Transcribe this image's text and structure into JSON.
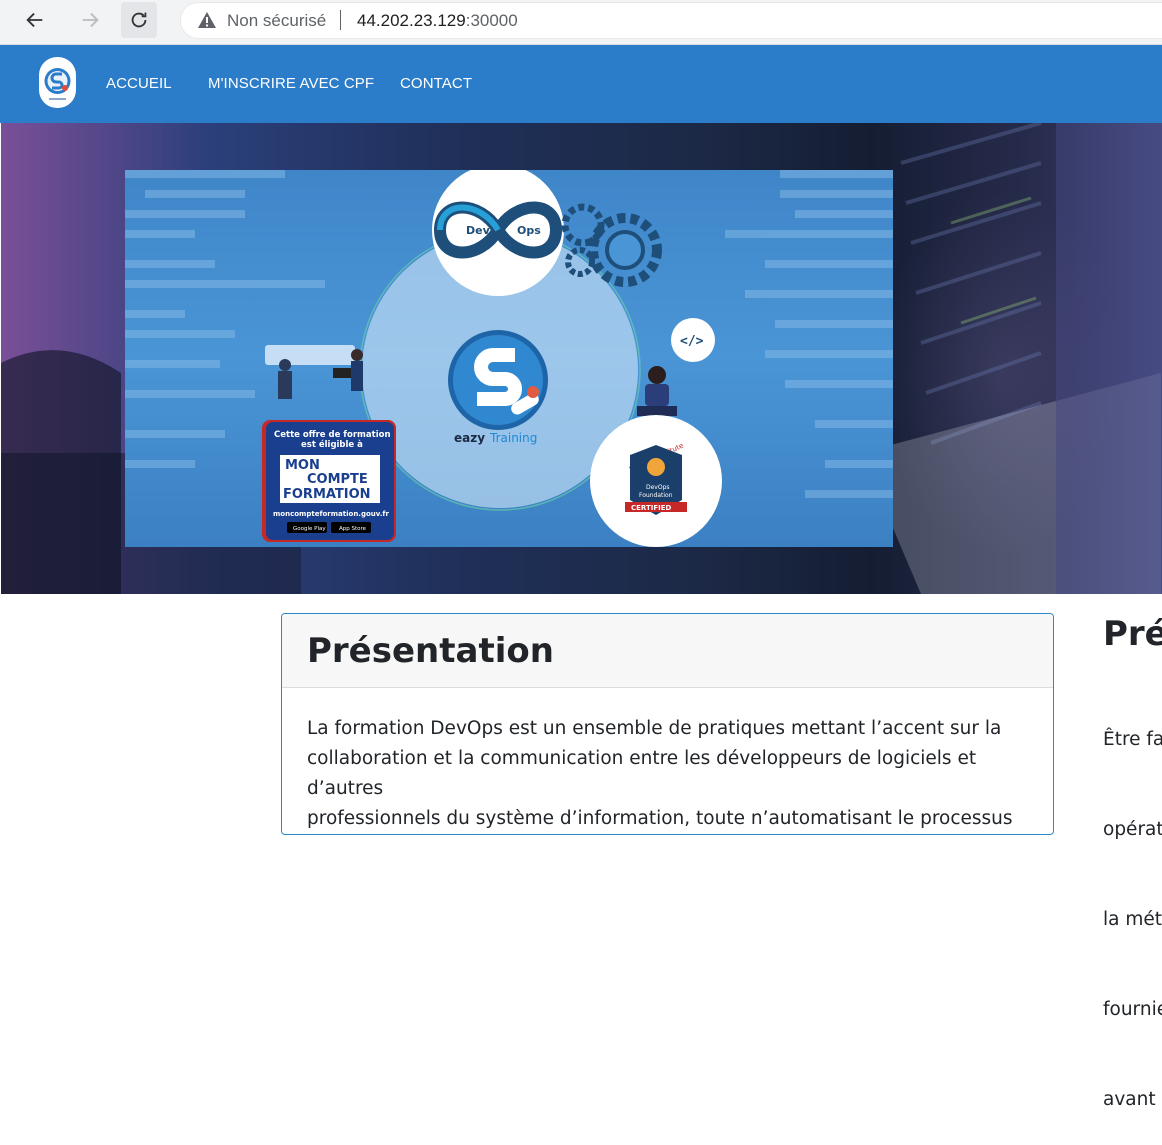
{
  "browser": {
    "security_label": "Non sécurisé",
    "url_host": "44.202.23.129",
    "url_port": ":30000"
  },
  "nav": {
    "items": [
      {
        "label": "ACCUEIL"
      },
      {
        "label": "M'INSCRIRE AVEC CPF"
      },
      {
        "label": "CONTACT"
      }
    ]
  },
  "banner": {
    "devops_left": "Dev",
    "devops_right": "Ops",
    "code_tag": "</>",
    "brand_name_part1": "eazy",
    "brand_name_part2": "Training",
    "cpf_line1": "Cette offre de formation",
    "cpf_line2": "est éligible à",
    "cpf_mon": "MON",
    "cpf_compte": "COMPTE",
    "cpf_formation": "FORMATION",
    "cpf_url": "moncompteformation.gouv.fr",
    "store_google": "Google Play",
    "store_apple": "App Store",
    "badge_arc": "DevOps Institute",
    "badge_line1": "DevOps",
    "badge_line2": "Foundation",
    "badge_certified": "CERTIFIED"
  },
  "main": {
    "card_title": "Présentation",
    "card_text_lines": [
      "La formation DevOps est un ensemble de pratiques mettant l’accent sur la",
      "collaboration et la communication entre les développeurs de logiciels et d’autres",
      "professionnels du système d’information, toute n’automatisant le processus de"
    ],
    "side_title": "Prér",
    "side_lines": [
      "Être far",
      "opérat",
      "la méth",
      "fournie",
      "avant d"
    ]
  },
  "colors": {
    "nav_bg": "#2b7cc9",
    "card_border": "#2a8ac4",
    "badge_red": "#c62828"
  }
}
